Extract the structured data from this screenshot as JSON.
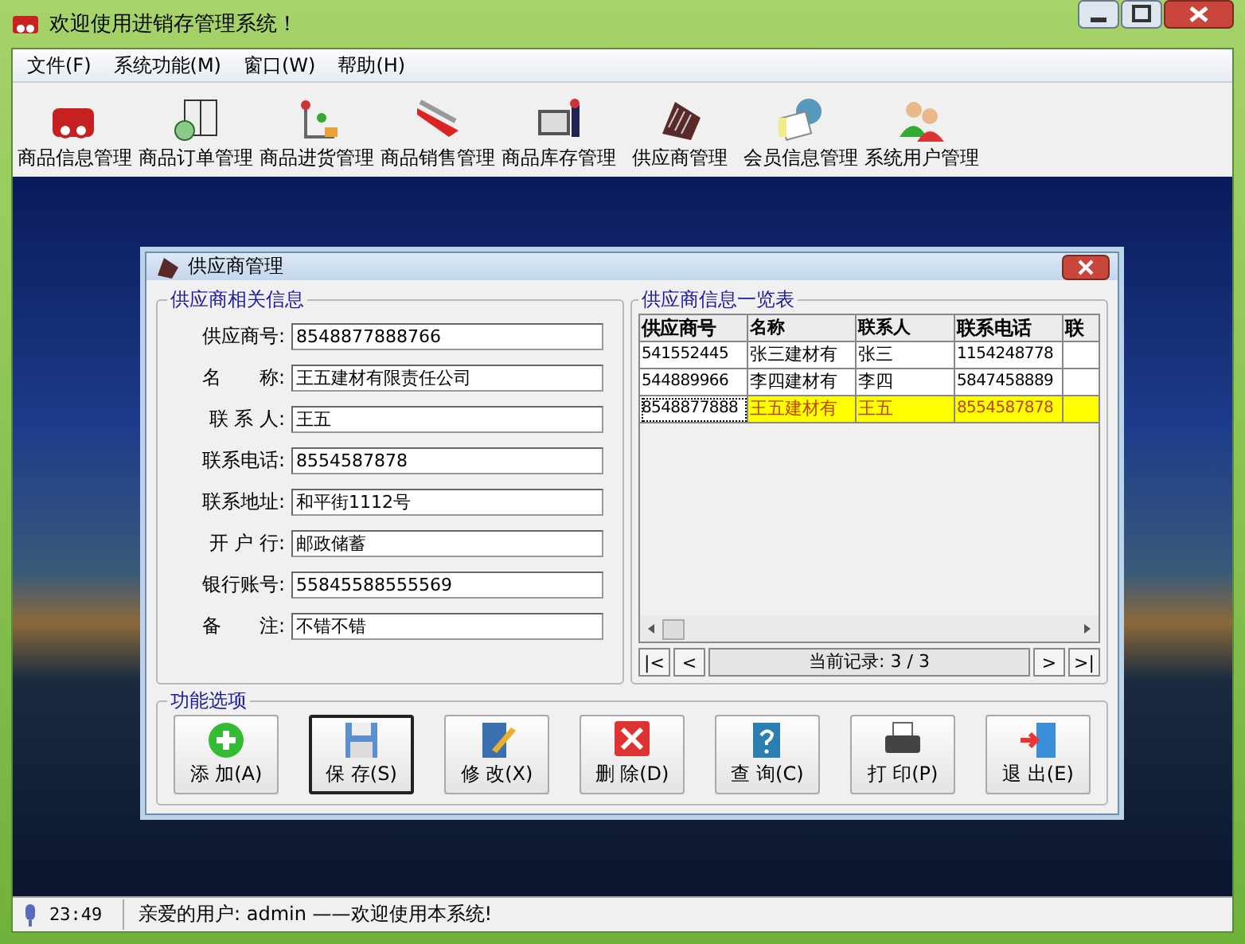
{
  "window": {
    "title": "欢迎使用进销存管理系统！"
  },
  "menu": [
    "文件(F)",
    "系统功能(M)",
    "窗口(W)",
    "帮助(H)"
  ],
  "toolbar": [
    {
      "label": "商品信息管理"
    },
    {
      "label": "商品订单管理"
    },
    {
      "label": "商品进货管理"
    },
    {
      "label": "商品销售管理"
    },
    {
      "label": "商品库存管理"
    },
    {
      "label": "供应商管理"
    },
    {
      "label": "会员信息管理"
    },
    {
      "label": "系统用户管理"
    }
  ],
  "dialog": {
    "title": "供应商管理",
    "form": {
      "title": "供应商相关信息",
      "fields": [
        {
          "label": "供应商号:",
          "value": "8548877888766"
        },
        {
          "label": "名　　称:",
          "value": "王五建材有限责任公司"
        },
        {
          "label": "联 系 人:",
          "value": "王五"
        },
        {
          "label": "联系电话:",
          "value": "8554587878"
        },
        {
          "label": "联系地址:",
          "value": "和平街1112号"
        },
        {
          "label": "开 户 行:",
          "value": "邮政储蓄"
        },
        {
          "label": "银行账号:",
          "value": "55845588555569"
        },
        {
          "label": "备　　注:",
          "value": "不错不错"
        }
      ]
    },
    "table": {
      "title": "供应商信息一览表",
      "columns": [
        "供应商号",
        "名称",
        "联系人",
        "联系电话",
        "联"
      ],
      "rows": [
        {
          "cells": [
            "541552445",
            "张三建材有",
            "张三",
            "1154248778"
          ],
          "selected": false
        },
        {
          "cells": [
            "544889966",
            "李四建材有",
            "李四",
            "5847458889"
          ],
          "selected": false
        },
        {
          "cells": [
            "8548877888",
            "王五建材有",
            "王五",
            "8554587878"
          ],
          "selected": true
        }
      ],
      "nav": {
        "first": "|<",
        "prev": "<",
        "record": "当前记录: 3 / 3",
        "next": ">",
        "last": ">|"
      }
    },
    "actions": {
      "title": "功能选项",
      "buttons": [
        {
          "label": "添 加(A)",
          "default": false
        },
        {
          "label": "保 存(S)",
          "default": true
        },
        {
          "label": "修 改(X)",
          "default": false
        },
        {
          "label": "删 除(D)",
          "default": false
        },
        {
          "label": "查 询(C)",
          "default": false
        },
        {
          "label": "打 印(P)",
          "default": false
        },
        {
          "label": "退 出(E)",
          "default": false
        }
      ]
    }
  },
  "status_bar": {
    "time": "23:49",
    "message": "亲爱的用户: admin ——欢迎使用本系统!"
  }
}
